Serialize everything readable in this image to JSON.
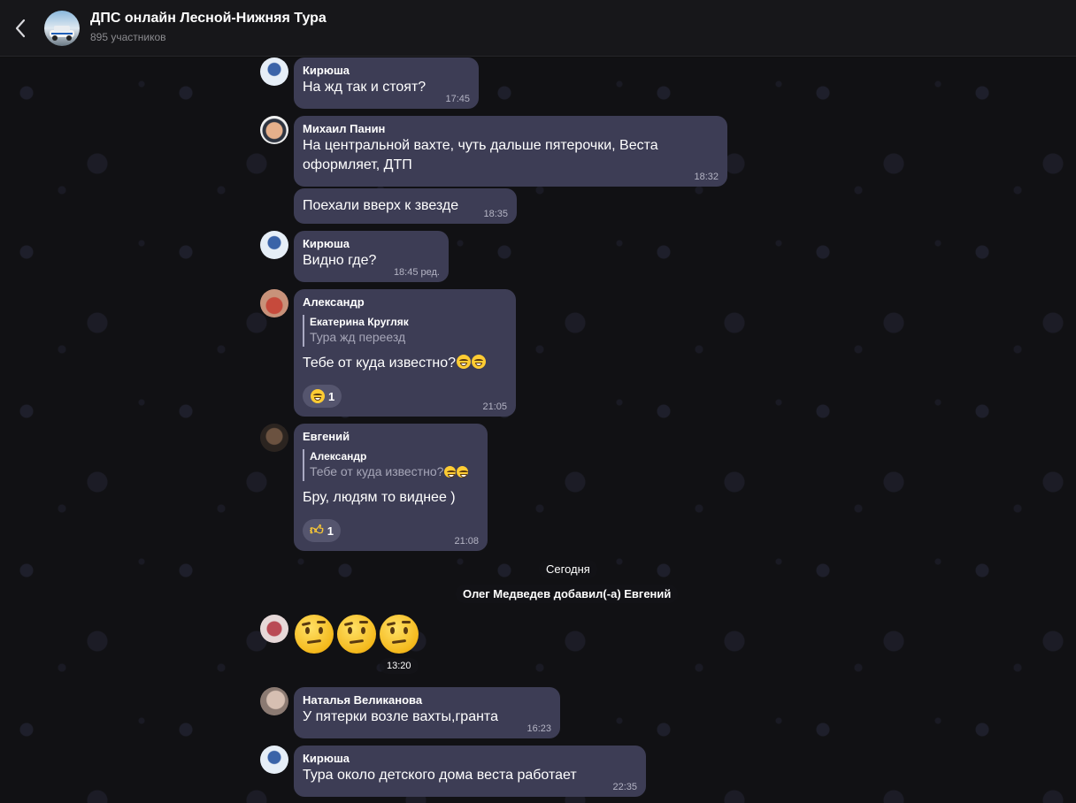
{
  "header": {
    "title": "ДПС онлайн Лесной-Нижняя Тура",
    "subtitle": "895 участников"
  },
  "messages": [
    {
      "sender": "Кирюша",
      "text": "На жд так и стоят?",
      "time": "17:45"
    },
    {
      "sender": "Михаил Панин",
      "text_line1": "На центральной вахте, чуть дальше пятерочки, Веста",
      "text_line2": "оформляет, ДТП",
      "time": "18:32"
    },
    {
      "text": "Поехали вверх к звезде",
      "time": "18:35"
    },
    {
      "sender": "Кирюша",
      "text": "Видно где?",
      "time": "18:45 ред."
    },
    {
      "sender": "Александр",
      "reply_name": "Екатерина Кругляк",
      "reply_text": "Тура жд переезд",
      "text": "Тебе от куда известно?",
      "reaction_count": "1",
      "time": "21:05"
    },
    {
      "sender": "Евгений",
      "reply_name": "Александр",
      "reply_text": "Тебе от куда известно?",
      "text": "Бру, людям то виднее )",
      "reaction_count": "1",
      "time": "21:08"
    },
    {
      "time": "13:20"
    },
    {
      "sender": "Наталья Великанова",
      "text": "У пятерки возле вахты,гранта",
      "time": "16:23"
    },
    {
      "sender": "Кирюша",
      "text": "Тура около детского дома веста работает",
      "time": "22:35"
    }
  ],
  "service": {
    "date": "Сегодня",
    "added": "Олег Медведев добавил(-а) Евгений"
  },
  "icons": {
    "back": "chevron-left-icon",
    "reaction_1": "grinning-face-icon",
    "reaction_2": "thumbs-up-icon",
    "sticker": "raised-eyebrow-face-icon"
  }
}
